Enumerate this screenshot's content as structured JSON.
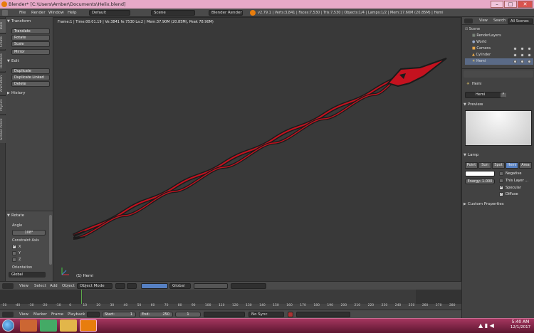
{
  "window": {
    "title": "Blender* [C:\\Users\\Amber\\Documents\\Helix.blend]",
    "buttons": {
      "minimize": "–",
      "maximize": "□",
      "close": "✕"
    }
  },
  "info_header": {
    "menus": [
      "File",
      "Render",
      "Window",
      "Help"
    ],
    "screen_layout": "Default",
    "scene": "Scene",
    "render_engine": "Blender Render",
    "stats": "v2.79.1 | Verts:3,841 | Faces:7,530 | Tris:7,530 | Objects:1/4 | Lamps:1/2 | Mem:17.60M (20.85M) | Hemi"
  },
  "toolshelf": {
    "tabs": [
      "Tools",
      "Create",
      "Relations",
      "Animation",
      "Physics",
      "Grease Pencil"
    ],
    "transform": {
      "title": "Transform",
      "buttons": [
        "Translate",
        "Rotate",
        "Scale",
        "Mirror"
      ]
    },
    "edit": {
      "title": "Edit",
      "buttons": [
        "Duplicate",
        "Duplicate Linked",
        "Delete"
      ]
    },
    "history": {
      "title": "History"
    },
    "rotate_op": {
      "title": "Rotate",
      "angle_label": "Angle",
      "angle_value": "108°",
      "constraint_label": "Constraint Axis",
      "axes": [
        {
          "label": "X",
          "checked": true
        },
        {
          "label": "Y",
          "checked": false
        },
        {
          "label": "Z",
          "checked": false
        }
      ],
      "orientation_label": "Orientation",
      "orientation_value": "Global"
    }
  },
  "viewport": {
    "info_text": "Frame:1 | Time:00:01.19 | Ve:3841 fe:7530 La:2 | Mem:37.90M (20.85M), Peak 78.90M)",
    "object_label": "(1) Hemi"
  },
  "view3d_header": {
    "menus": [
      "View",
      "Select",
      "Add",
      "Object"
    ],
    "mode": "Object Mode",
    "orientation": "Global"
  },
  "timeline": {
    "ruler": [
      "-50",
      "-40",
      "-30",
      "-20",
      "-10",
      "0",
      "10",
      "20",
      "30",
      "40",
      "50",
      "60",
      "70",
      "80",
      "90",
      "100",
      "110",
      "120",
      "130",
      "140",
      "150",
      "160",
      "170",
      "180",
      "190",
      "200",
      "210",
      "220",
      "230",
      "240",
      "250",
      "260",
      "270",
      "280"
    ],
    "current_frame_fraction": 0.176
  },
  "timeline_header": {
    "menus": [
      "View",
      "Marker",
      "Frame",
      "Playback"
    ],
    "start_label": "Start:",
    "start_value": "1",
    "end_label": "End:",
    "end_value": "250",
    "current_frame": "1",
    "sync": "No Sync"
  },
  "outliner": {
    "tabs": [
      "View",
      "Search",
      "All Scenes"
    ],
    "items": [
      {
        "label": "Scene",
        "indent": 0
      },
      {
        "label": "RenderLayers",
        "indent": 1
      },
      {
        "label": "World",
        "indent": 1
      },
      {
        "label": "Camera",
        "indent": 1
      },
      {
        "label": "Cylinder",
        "indent": 1
      },
      {
        "label": "Hemi",
        "indent": 1
      }
    ]
  },
  "properties": {
    "breadcrumb": "Hemi",
    "datablock_name": "Hemi",
    "datablock_users": "F",
    "preview_title": "Preview",
    "lamp_title": "Lamp",
    "lamp_types": [
      "Point",
      "Sun",
      "Spot",
      "Hemi",
      "Area"
    ],
    "active_lamp_type": "Hemi",
    "energy_label": "Energy:",
    "energy_value": "1.000",
    "options": [
      {
        "label": "Negative",
        "checked": false
      },
      {
        "label": "This Layer ...",
        "checked": false
      },
      {
        "label": "Specular",
        "checked": true
      },
      {
        "label": "Diffuse",
        "checked": true
      }
    ],
    "custom_props_title": "Custom Properties"
  },
  "taskbar": {
    "time": "5:40 AM",
    "date": "12/1/2017"
  },
  "colors": {
    "helix_red": "#c4121f",
    "helix_dark": "#1b1b1b",
    "active_blue": "#5680c2",
    "taskbar": "#8a2448"
  }
}
